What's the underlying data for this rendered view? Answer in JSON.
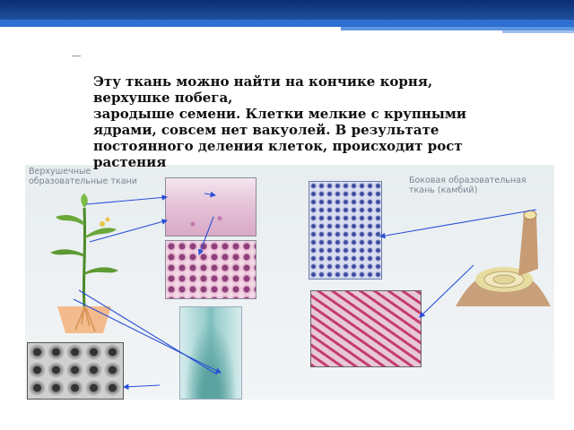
{
  "slide": {
    "text_lines": [
      "Эту ткань можно найти на кончике корня,",
      "верхушке побега,",
      "зародыше семени. Клетки мелкие с крупными",
      "ядрами, совсем нет вакуолей. В результате",
      "постоянного деления клеток, происходит рост",
      "растения"
    ]
  },
  "figure": {
    "label_apical_line1": "Верхушечные",
    "label_apical_line2": "образовательные ткани",
    "label_lateral_line1": "Боковая образовательная",
    "label_lateral_line2": "ткань (камбий)"
  },
  "colors": {
    "header_dark": "#0b2f72",
    "header_light": "#2f6fd0",
    "arrow": "#2a4fd6",
    "text": "#111111"
  }
}
